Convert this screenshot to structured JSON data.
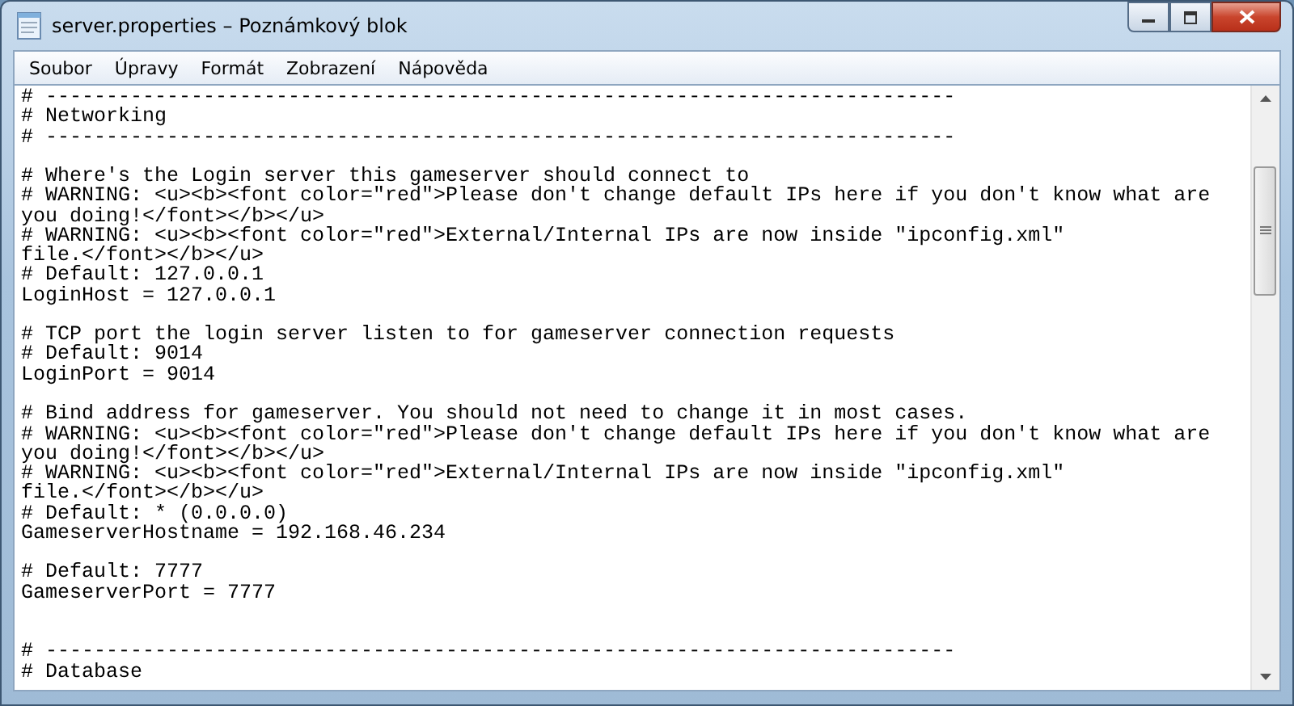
{
  "window": {
    "title": "server.properties – Poznámkový blok"
  },
  "menu": [
    "Soubor",
    "Úpravy",
    "Formát",
    "Zobrazení",
    "Nápověda"
  ],
  "editor": {
    "lines": [
      {
        "kind": "text",
        "text": "# ---------------------------------------------------------------------------"
      },
      {
        "kind": "text",
        "text": "# Networking"
      },
      {
        "kind": "text",
        "text": "# ---------------------------------------------------------------------------"
      },
      {
        "kind": "blank"
      },
      {
        "kind": "text",
        "text": "# Where's the Login server this gameserver should connect to"
      },
      {
        "kind": "text",
        "text": "# WARNING: <u><b><font color=\"red\">Please don't change default IPs here if you don't know what are"
      },
      {
        "kind": "text",
        "text": "you doing!</font></b></u>"
      },
      {
        "kind": "text",
        "text": "# WARNING: <u><b><font color=\"red\">External/Internal IPs are now inside \"ipconfig.xml\""
      },
      {
        "kind": "text",
        "text": "file.</font></b></u>"
      },
      {
        "kind": "text",
        "text": "# Default: 127.0.0.1"
      },
      {
        "kind": "text",
        "text": "LoginHost = 127.0.0.1"
      },
      {
        "kind": "blank"
      },
      {
        "kind": "text",
        "text": "# TCP port the login server listen to for gameserver connection requests"
      },
      {
        "kind": "text",
        "text": "# Default: 9014"
      },
      {
        "kind": "text",
        "text": "LoginPort = 9014"
      },
      {
        "kind": "blank"
      },
      {
        "kind": "text",
        "text": "# Bind address for gameserver. You should not need to change it in most cases."
      },
      {
        "kind": "text",
        "text": "# WARNING: <u><b><font color=\"red\">Please don't change default IPs here if you don't know what are"
      },
      {
        "kind": "text",
        "text": "you doing!</font></b></u>"
      },
      {
        "kind": "text",
        "text": "# WARNING: <u><b><font color=\"red\">External/Internal IPs are now inside \"ipconfig.xml\""
      },
      {
        "kind": "text",
        "text": "file.</font></b></u>"
      },
      {
        "kind": "text",
        "text": "# Default: * (0.0.0.0)"
      },
      {
        "kind": "text",
        "text": "GameserverHostname = 192.168.46.234"
      },
      {
        "kind": "blank"
      },
      {
        "kind": "text",
        "text": "# Default: 7777"
      },
      {
        "kind": "text",
        "text": "GameserverPort = 7777"
      },
      {
        "kind": "blank"
      },
      {
        "kind": "blank"
      },
      {
        "kind": "text",
        "text": "# ---------------------------------------------------------------------------"
      },
      {
        "kind": "text",
        "text": "# Database"
      }
    ]
  }
}
